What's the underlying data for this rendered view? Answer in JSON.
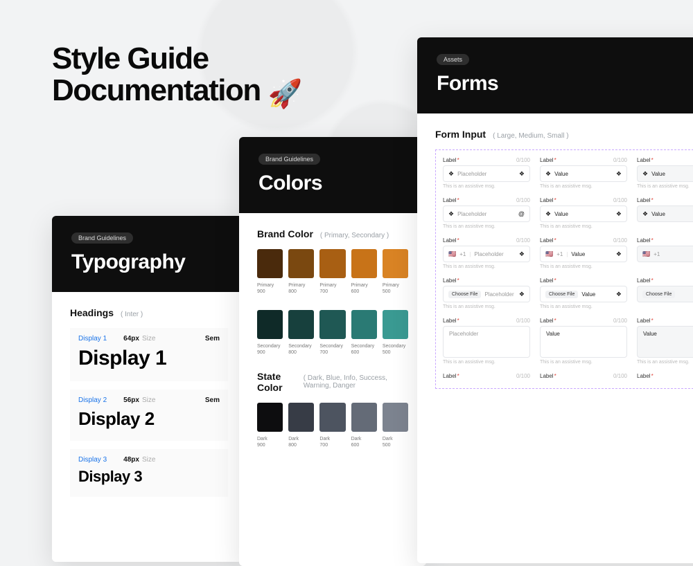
{
  "hero": {
    "line1": "Style Guide",
    "line2": "Documentation",
    "emoji": "🚀"
  },
  "cards": {
    "typography": {
      "pill": "Brand Guidelines",
      "title": "Typography",
      "section": "Headings",
      "section_sub": "( Inter )",
      "weight_abbrev": "Sem",
      "size_label": "Size",
      "rows": [
        {
          "name": "Display 1",
          "size": "64px",
          "sample": "Display 1"
        },
        {
          "name": "Display 2",
          "size": "56px",
          "sample": "Display 2"
        },
        {
          "name": "Display 3",
          "size": "48px",
          "sample": "Display 3"
        }
      ]
    },
    "colors": {
      "pill": "Brand Guidelines",
      "title": "Colors",
      "brand_section": "Brand Color",
      "brand_sub": "( Primary, Secondary )",
      "state_section": "State Color",
      "state_sub": "( Dark, Blue, Info, Success, Warning, Danger",
      "primary": [
        {
          "label": "Primary",
          "shade": "900",
          "hex": "#4a2a0c"
        },
        {
          "label": "Primary",
          "shade": "800",
          "hex": "#7a4810"
        },
        {
          "label": "Primary",
          "shade": "700",
          "hex": "#a85f13"
        },
        {
          "label": "Primary",
          "shade": "600",
          "hex": "#c87318"
        },
        {
          "label": "Primary",
          "shade": "500",
          "hex": "#d98324"
        }
      ],
      "secondary": [
        {
          "label": "Secondary",
          "shade": "900",
          "hex": "#0f2a28"
        },
        {
          "label": "Secondary",
          "shade": "800",
          "hex": "#17403d"
        },
        {
          "label": "Secondary",
          "shade": "700",
          "hex": "#1f5854"
        },
        {
          "label": "Secondary",
          "shade": "600",
          "hex": "#2a7a74"
        },
        {
          "label": "Secondary",
          "shade": "500",
          "hex": "#3a9a92"
        }
      ],
      "dark": [
        {
          "label": "Dark",
          "shade": "900",
          "hex": "#0d0d0f"
        },
        {
          "label": "Dark",
          "shade": "800",
          "hex": "#373c46"
        },
        {
          "label": "Dark",
          "shade": "700",
          "hex": "#4d5460"
        },
        {
          "label": "Dark",
          "shade": "600",
          "hex": "#646b77"
        },
        {
          "label": "Dark",
          "shade": "500",
          "hex": "#7c838f"
        }
      ]
    },
    "forms": {
      "pill": "Assets",
      "title": "Forms",
      "section": "Form Input",
      "section_sub": "( Large, Medium, Small )",
      "label": "Label",
      "required": "*",
      "counter": "0/100",
      "placeholder": "Placeholder",
      "value": "Value",
      "assist": "This is an assistive msg.",
      "choose_file": "Choose File",
      "dial_prefix": "+1",
      "flag": "🇺🇸",
      "icon_lead": "❖",
      "icon_trail": "❖",
      "icon_at": "@"
    }
  }
}
